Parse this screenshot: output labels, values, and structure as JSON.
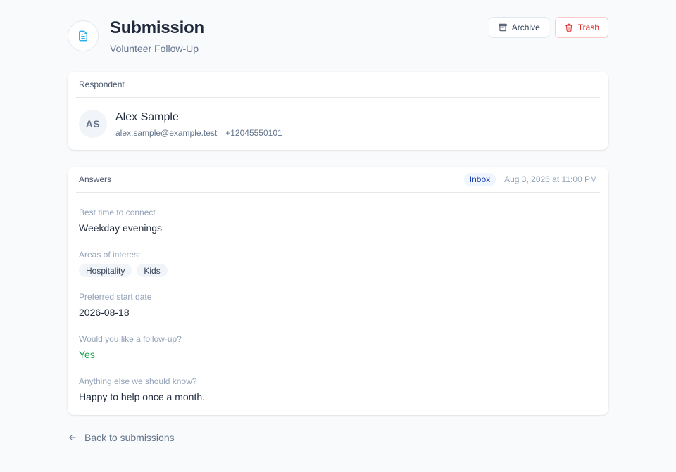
{
  "header": {
    "title": "Submission",
    "subtitle": "Volunteer Follow-Up",
    "icon": "document-icon",
    "archive_label": "Archive",
    "trash_label": "Trash"
  },
  "respondent": {
    "section_label": "Respondent",
    "initials": "AS",
    "name": "Alex Sample",
    "email": "alex.sample@example.test",
    "phone": "+12045550101"
  },
  "answers": {
    "section_label": "Answers",
    "status": "Inbox",
    "submitted_at": "Aug 3, 2026 at 11:00 PM",
    "items": [
      {
        "question": "Best time to connect",
        "answer": "Weekday evenings"
      },
      {
        "question": "Areas of interest",
        "tags": [
          "Hospitality",
          "Kids"
        ]
      },
      {
        "question": "Preferred start date",
        "answer": "2026-08-18"
      },
      {
        "question": "Would you like a follow-up?",
        "answer": "Yes"
      },
      {
        "question": "Anything else we should know?",
        "answer": "Happy to help once a month."
      }
    ]
  },
  "footer": {
    "back_label": "Back to submissions"
  },
  "colors": {
    "accent": "#0ea5e9",
    "danger": "#dc2626",
    "success": "#16a34a",
    "status_bg": "#eff6ff",
    "status_text": "#1e40af"
  }
}
